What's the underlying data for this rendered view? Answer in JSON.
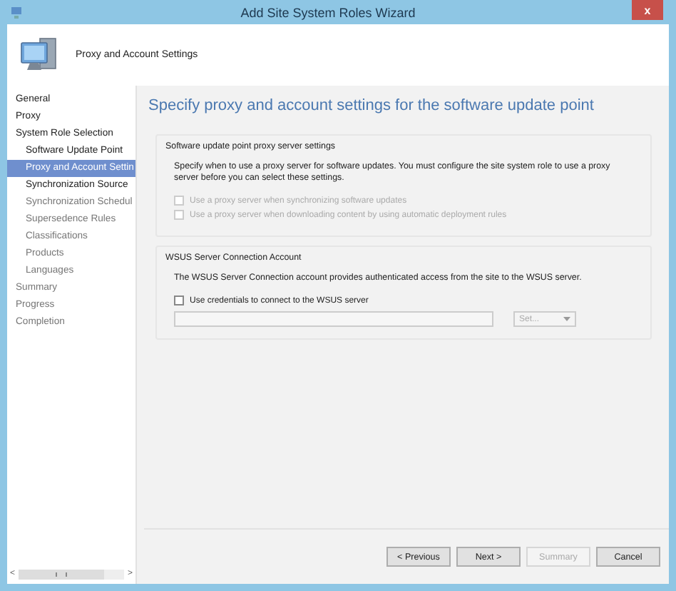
{
  "window": {
    "title": "Add Site System Roles Wizard",
    "close": "x"
  },
  "header": {
    "title": "Proxy and Account Settings"
  },
  "nav": {
    "items": [
      {
        "label": "General",
        "selected": false,
        "disabled": false
      },
      {
        "label": "Proxy",
        "selected": false,
        "disabled": false
      },
      {
        "label": "System Role Selection",
        "selected": false,
        "disabled": false,
        "children": [
          {
            "label": "Software Update Point",
            "selected": false,
            "disabled": false
          },
          {
            "label": "Proxy and Account Settin",
            "selected": true,
            "disabled": false
          },
          {
            "label": "Synchronization Source",
            "selected": false,
            "disabled": false
          },
          {
            "label": "Synchronization Schedul",
            "selected": false,
            "disabled": true
          },
          {
            "label": "Supersedence Rules",
            "selected": false,
            "disabled": true
          },
          {
            "label": "Classifications",
            "selected": false,
            "disabled": true
          },
          {
            "label": "Products",
            "selected": false,
            "disabled": true
          },
          {
            "label": "Languages",
            "selected": false,
            "disabled": true
          }
        ]
      },
      {
        "label": "Summary",
        "selected": false,
        "disabled": true
      },
      {
        "label": "Progress",
        "selected": false,
        "disabled": true
      },
      {
        "label": "Completion",
        "selected": false,
        "disabled": true
      }
    ]
  },
  "main": {
    "heading": "Specify proxy and account settings for the software update point",
    "groups": [
      {
        "title": "Software update point proxy server settings",
        "description": "Specify when to use a proxy server for software updates. You must configure the site system role to use a proxy server before you can select these settings.",
        "checkboxes": [
          {
            "label": "Use a proxy server when synchronizing software updates",
            "checked": false,
            "disabled": true
          },
          {
            "label": "Use a proxy server when downloading content by using automatic deployment rules",
            "checked": false,
            "disabled": true
          }
        ]
      },
      {
        "title": "WSUS Server Connection Account",
        "description": "The WSUS Server Connection account provides authenticated access from the site to the WSUS server.",
        "checkboxes": [
          {
            "label": "Use credentials to connect to the WSUS server",
            "checked": false,
            "disabled": false
          }
        ],
        "account": {
          "set_button": "Set...",
          "disabled": true
        }
      }
    ]
  },
  "buttons": [
    {
      "label": "< Previous",
      "disabled": false
    },
    {
      "label": "Next >",
      "disabled": false
    },
    {
      "label": "Summary",
      "disabled": true
    },
    {
      "label": "Cancel",
      "disabled": false
    }
  ],
  "scrollbar": {
    "left": "<",
    "right": ">"
  }
}
